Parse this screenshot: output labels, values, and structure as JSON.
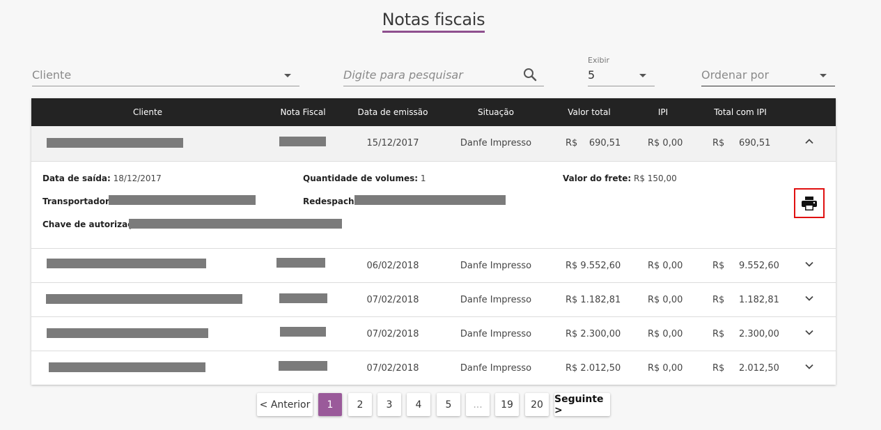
{
  "page_title": "Notas fiscais",
  "filters": {
    "cliente_placeholder": "Cliente",
    "search_placeholder": "Digite para pesquisar",
    "exibir_label": "Exibir",
    "exibir_value": "5",
    "ordenar_placeholder": "Ordenar por"
  },
  "table": {
    "headers": {
      "cliente": "Cliente",
      "nota": "Nota Fiscal",
      "data": "Data de emissão",
      "situacao": "Situação",
      "valor": "Valor total",
      "ipi": "IPI",
      "total": "Total com IPI"
    },
    "rows": [
      {
        "data": "15/12/2017",
        "situacao": "Danfe Impresso",
        "valor": "R$    690,51",
        "ipi": "R$ 0,00",
        "total": "R$     690,51"
      },
      {
        "data": "06/02/2018",
        "situacao": "Danfe Impresso",
        "valor": "R$ 9.552,60",
        "ipi": "R$ 0,00",
        "total": "R$     9.552,60"
      },
      {
        "data": "07/02/2018",
        "situacao": "Danfe Impresso",
        "valor": "R$ 1.182,81",
        "ipi": "R$ 0,00",
        "total": "R$     1.182,81"
      },
      {
        "data": "07/02/2018",
        "situacao": "Danfe Impresso",
        "valor": "R$ 2.300,00",
        "ipi": "R$ 0,00",
        "total": "R$     2.300,00"
      },
      {
        "data": "07/02/2018",
        "situacao": "Danfe Impresso",
        "valor": "R$ 2.012,50",
        "ipi": "R$ 0,00",
        "total": "R$     2.012,50"
      }
    ]
  },
  "detail": {
    "data_saida_label": "Data de saída:",
    "data_saida_value": "18/12/2017",
    "quantidade_label": "Quantidade de volumes:",
    "quantidade_value": "1",
    "frete_label": "Valor do frete:",
    "frete_value": "R$ 150,00",
    "transportadora_label": "Transportadora:",
    "redespacho_label": "Redespacho:",
    "chave_label": "Chave de autorização:"
  },
  "pagination": {
    "prev": "< Anterior",
    "pages": [
      "1",
      "2",
      "3",
      "4",
      "5",
      "...",
      "19",
      "20"
    ],
    "next": "Seguinte >"
  },
  "colors": {
    "accent": "#9a5a9a",
    "header_bg": "#232323",
    "highlight": "#e01010"
  },
  "icons": [
    "search-icon",
    "chevron-down-icon",
    "chevron-up-icon",
    "printer-icon"
  ]
}
